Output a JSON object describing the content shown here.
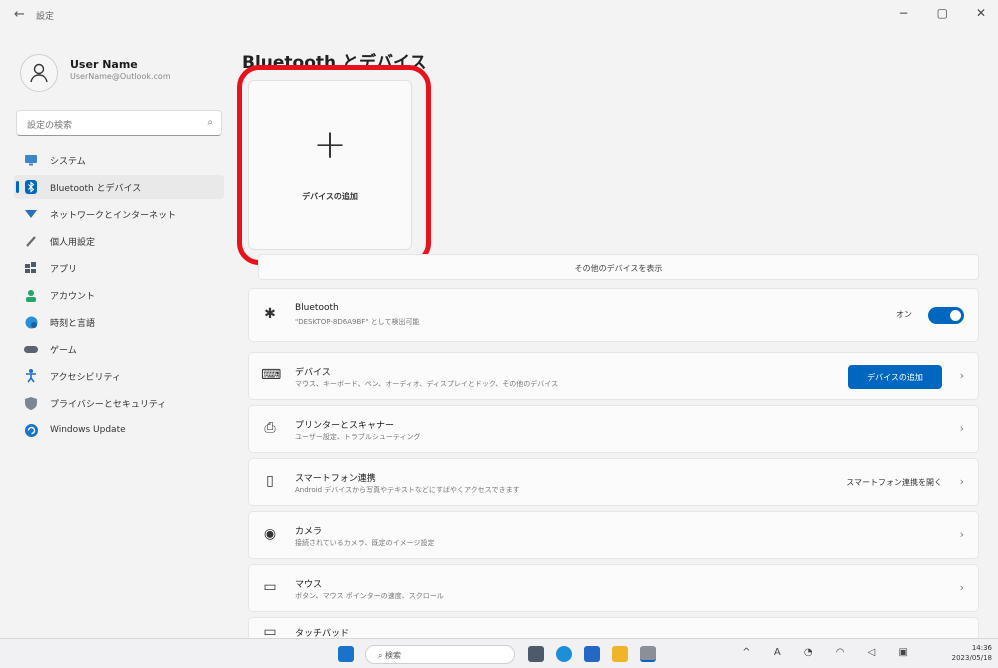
{
  "window": {
    "back_glyph": "←",
    "title": "設定",
    "controls": [
      "−",
      "▢",
      "✕"
    ]
  },
  "user": {
    "name": "User Name",
    "email": "UserName@Outlook.com"
  },
  "search": {
    "placeholder": "設定の検索"
  },
  "nav": [
    {
      "label": "システム",
      "icon": "monitor-icon",
      "color": "#3f86c8",
      "active": false
    },
    {
      "label": "Bluetooth とデバイス",
      "icon": "bluetooth-icon",
      "color": "#0067c0",
      "active": true
    },
    {
      "label": "ネットワークとインターネット",
      "icon": "wifi-icon",
      "color": "#2b6cc4",
      "active": false
    },
    {
      "label": "個人用設定",
      "icon": "brush-icon",
      "color": "#6a6a6a",
      "active": false
    },
    {
      "label": "アプリ",
      "icon": "apps-icon",
      "color": "#505a6e",
      "active": false
    },
    {
      "label": "アカウント",
      "icon": "account-icon",
      "color": "#25a56a",
      "active": false
    },
    {
      "label": "時刻と言語",
      "icon": "globe-clock-icon",
      "color": "#2a8fd6",
      "active": false
    },
    {
      "label": "ゲーム",
      "icon": "gamepad-icon",
      "color": "#5c6470",
      "active": false
    },
    {
      "label": "アクセシビリティ",
      "icon": "accessibility-icon",
      "color": "#1f6fd1",
      "active": false
    },
    {
      "label": "プライバシーとセキュリティ",
      "icon": "shield-icon",
      "color": "#7b8594",
      "active": false
    },
    {
      "label": "Windows Update",
      "icon": "update-icon",
      "color": "#1a73c9",
      "active": false
    }
  ],
  "main": {
    "title": "Bluetooth とデバイス",
    "add_tile": {
      "glyph": "+",
      "label": "デバイスの追加"
    },
    "highlight_color": "#e8121c",
    "show_more": "その他のデバイスを表示",
    "bluetooth": {
      "title": "Bluetooth",
      "subtitle": "\"DESKTOP-8D6A9BF\" として検出可能",
      "toggle_label": "オン",
      "toggle_on": true
    },
    "rows": [
      {
        "icon": "devices-icon",
        "glyph": "⌨",
        "title": "デバイス",
        "subtitle": "マウス、キーボード、ペン、オーディオ、ディスプレイとドック、その他のデバイス",
        "action_button": "デバイスの追加"
      },
      {
        "icon": "printer-icon",
        "glyph": "⎙",
        "title": "プリンターとスキャナー",
        "subtitle": "ユーザー設定、トラブルシューティング",
        "action_button": ""
      },
      {
        "icon": "phone-icon",
        "glyph": "▯",
        "title": "スマートフォン連携",
        "subtitle": "Android デバイスから写真やテキストなどにすばやくアクセスできます",
        "action_link": "スマートフォン連携を開く"
      },
      {
        "icon": "camera-icon",
        "glyph": "◉",
        "title": "カメラ",
        "subtitle": "接続されているカメラ、既定のイメージ設定",
        "action_button": ""
      },
      {
        "icon": "mouse-icon",
        "glyph": "▭",
        "title": "マウス",
        "subtitle": "ボタン、マウス ポインターの速度、スクロール",
        "action_button": ""
      },
      {
        "icon": "touchpad-icon",
        "glyph": "▭",
        "title": "タッチパッド",
        "subtitle": "",
        "action_button": ""
      }
    ],
    "chevron": "›"
  },
  "taskbar": {
    "search_placeholder": "検索",
    "tray_glyphs": "^ A ◔ ◠ ◁ ▣",
    "time": "14:36",
    "date": "2023/05/18"
  },
  "colors": {
    "accent": "#0067c0"
  }
}
